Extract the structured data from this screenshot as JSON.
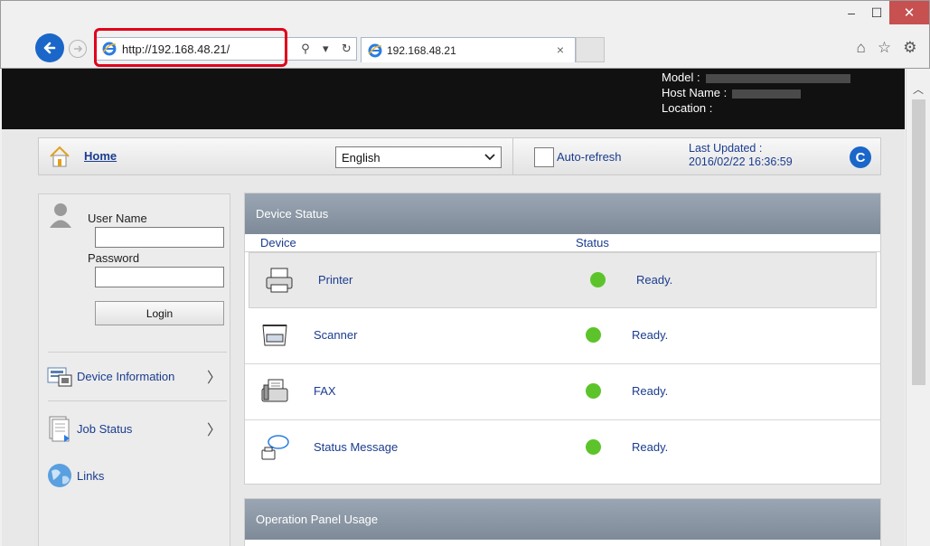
{
  "browser": {
    "address_url": "http://192.168.48.21/",
    "tab_title": "192.168.48.21",
    "tab_close": "×",
    "win_min": "–",
    "win_max": "☐",
    "win_close": "✕"
  },
  "header": {
    "model_label": "Model :",
    "host_label": "Host Name :",
    "location_label": "Location :"
  },
  "topbar": {
    "home_label": "Home",
    "language_selected": "English",
    "auto_refresh_label": "Auto-refresh",
    "last_updated_label": "Last Updated :",
    "last_updated_value": "2016/02/22 16:36:59",
    "refresh_glyph": "C"
  },
  "login": {
    "user_label": "User Name",
    "password_label": "Password",
    "login_button": "Login"
  },
  "sidebar": {
    "items": [
      {
        "label": "Device Information",
        "chevron": "〉"
      },
      {
        "label": "Job Status",
        "chevron": "〉"
      },
      {
        "label": "Links",
        "chevron": ""
      }
    ]
  },
  "device_status": {
    "title": "Device Status",
    "col_device": "Device",
    "col_status": "Status",
    "rows": [
      {
        "device": "Printer",
        "status": "Ready.",
        "status_color": "#5cc42a"
      },
      {
        "device": "Scanner",
        "status": "Ready.",
        "status_color": "#5cc42a"
      },
      {
        "device": "FAX",
        "status": "Ready.",
        "status_color": "#5cc42a"
      },
      {
        "device": "Status Message",
        "status": "Ready.",
        "status_color": "#5cc42a"
      }
    ]
  },
  "operation_panel": {
    "title": "Operation Panel Usage"
  },
  "colors": {
    "accent_blue": "#1b66c9",
    "highlight_red": "#e0001b",
    "link_blue": "#1a3c8f"
  }
}
